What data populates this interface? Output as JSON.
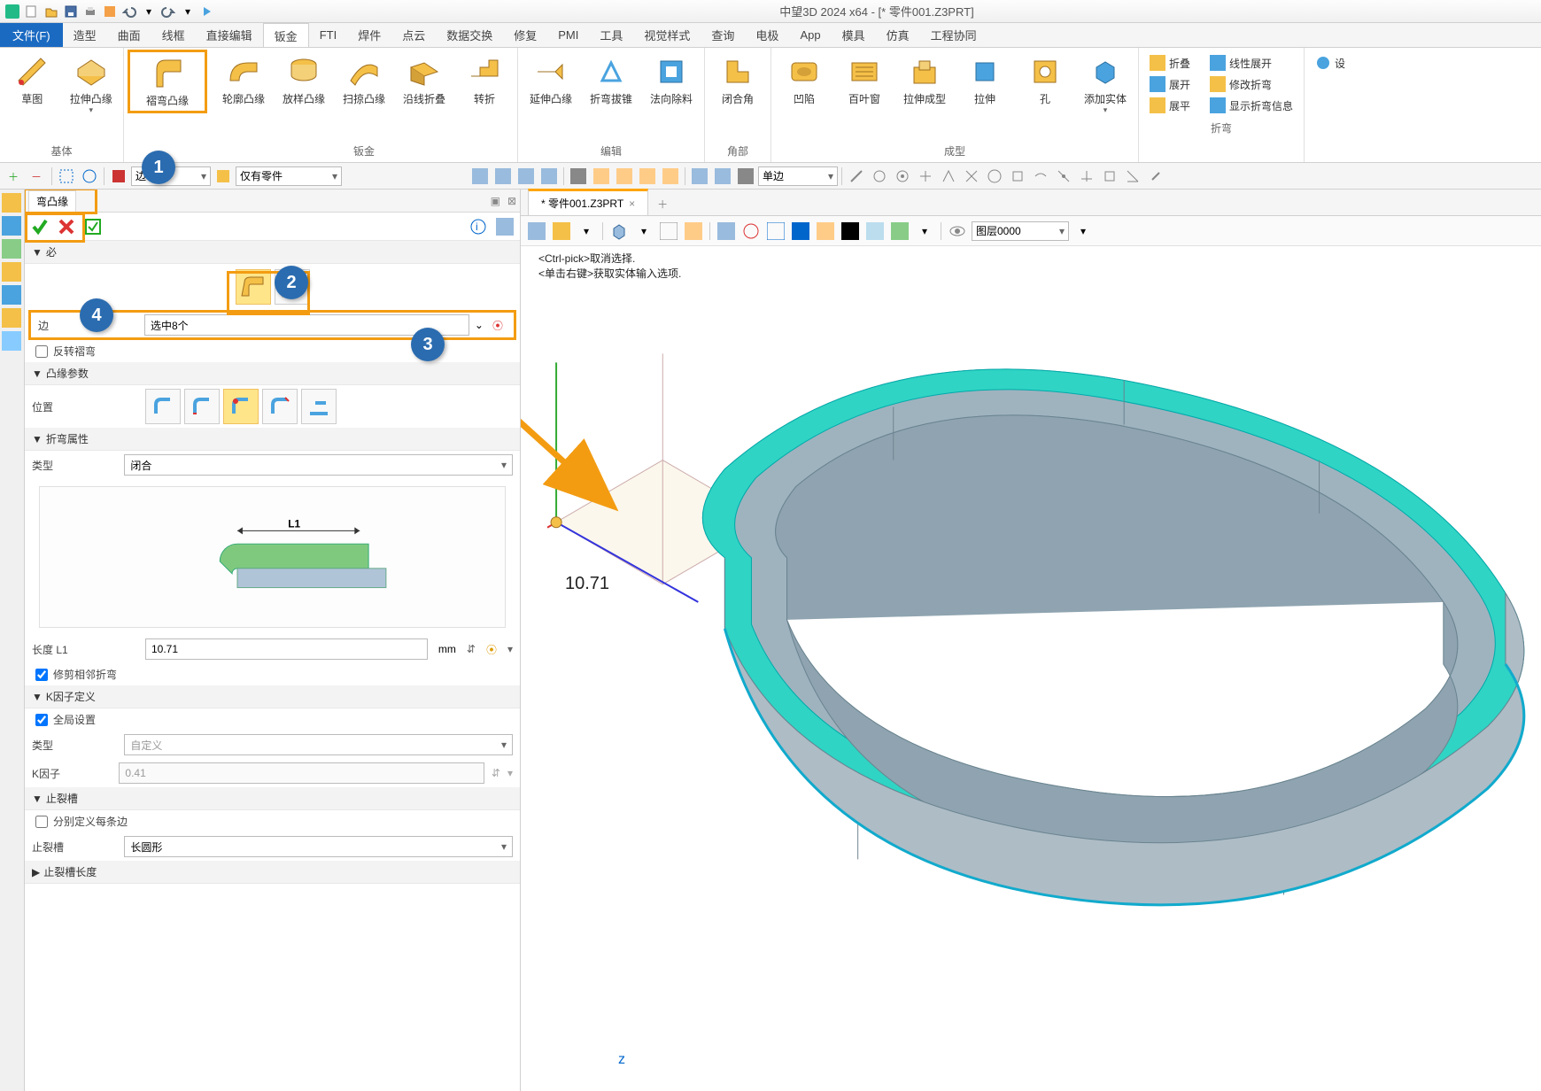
{
  "app": {
    "title": "中望3D 2024 x64 - [* 零件001.Z3PRT]"
  },
  "menu": {
    "file": "文件(F)",
    "items": [
      "造型",
      "曲面",
      "线框",
      "直接编辑",
      "钣金",
      "FTI",
      "焊件",
      "点云",
      "数据交换",
      "修复",
      "PMI",
      "工具",
      "视觉样式",
      "查询",
      "电极",
      "App",
      "模具",
      "仿真",
      "工程协同"
    ],
    "active": "钣金"
  },
  "ribbon": {
    "groups": [
      {
        "label": "基体",
        "items": [
          {
            "label": "草图"
          },
          {
            "label": "拉伸凸缘",
            "dropdown": true
          }
        ]
      },
      {
        "label": "",
        "items": [
          {
            "label": "褶弯凸缘",
            "highlight": true
          }
        ]
      },
      {
        "label": "钣金",
        "items": [
          {
            "label": "轮廓凸缘"
          },
          {
            "label": "放样凸缘"
          },
          {
            "label": "扫掠凸缘"
          },
          {
            "label": "沿线折叠"
          },
          {
            "label": "转折"
          }
        ]
      },
      {
        "label": "编辑",
        "items": [
          {
            "label": "延伸凸缘"
          },
          {
            "label": "折弯拔锥"
          },
          {
            "label": "法向除料"
          }
        ]
      },
      {
        "label": "角部",
        "items": [
          {
            "label": "闭合角"
          }
        ]
      },
      {
        "label": "成型",
        "items": [
          {
            "label": "凹陷"
          },
          {
            "label": "百叶窗"
          },
          {
            "label": "拉伸成型"
          },
          {
            "label": "拉伸"
          },
          {
            "label": "孔"
          },
          {
            "label": "添加实体",
            "dropdown": true
          }
        ]
      },
      {
        "label": "折弯",
        "small": true,
        "items": [
          {
            "label": "折叠"
          },
          {
            "label": "线性展开"
          },
          {
            "label": "展开"
          },
          {
            "label": "修改折弯"
          },
          {
            "label": "展平"
          },
          {
            "label": "显示折弯信息"
          }
        ]
      },
      {
        "label": "",
        "small": true,
        "items": [
          {
            "label": "设"
          }
        ]
      }
    ]
  },
  "toolbar2": {
    "filter": "边",
    "display": "仅有零件",
    "option": "单边",
    "layer": "图层0000"
  },
  "panel": {
    "title": "弯凸缘",
    "section_required": "必",
    "edge_label": "边",
    "edge_value": "选中8个",
    "reverse_label": "反转褶弯",
    "flange_params": "凸缘参数",
    "position_label": "位置",
    "bend_attr": "折弯属性",
    "type_label": "类型",
    "type_value": "闭合",
    "diagram_label": "L1",
    "length_label": "长度 L1",
    "length_value": "10.71",
    "length_unit": "mm",
    "trim_label": "修剪相邻折弯",
    "kfactor_def": "K因子定义",
    "global_label": "全局设置",
    "ktype_label": "类型",
    "ktype_value": "自定义",
    "kfactor_label": "K因子",
    "kfactor_value": "0.41",
    "relief": "止裂槽",
    "per_edge_label": "分别定义每条边",
    "relief_label": "止裂槽",
    "relief_value": "长圆形",
    "relief_len": "止裂槽长度"
  },
  "viewport": {
    "tab": "* 零件001.Z3PRT",
    "hint1": "<Ctrl-pick>取消选择.",
    "hint2": "<单击右键>获取实体输入选项.",
    "dim": "10.71",
    "axis_z": "z"
  },
  "callouts": {
    "c1": "1",
    "c2": "2",
    "c3": "3",
    "c4": "4"
  }
}
